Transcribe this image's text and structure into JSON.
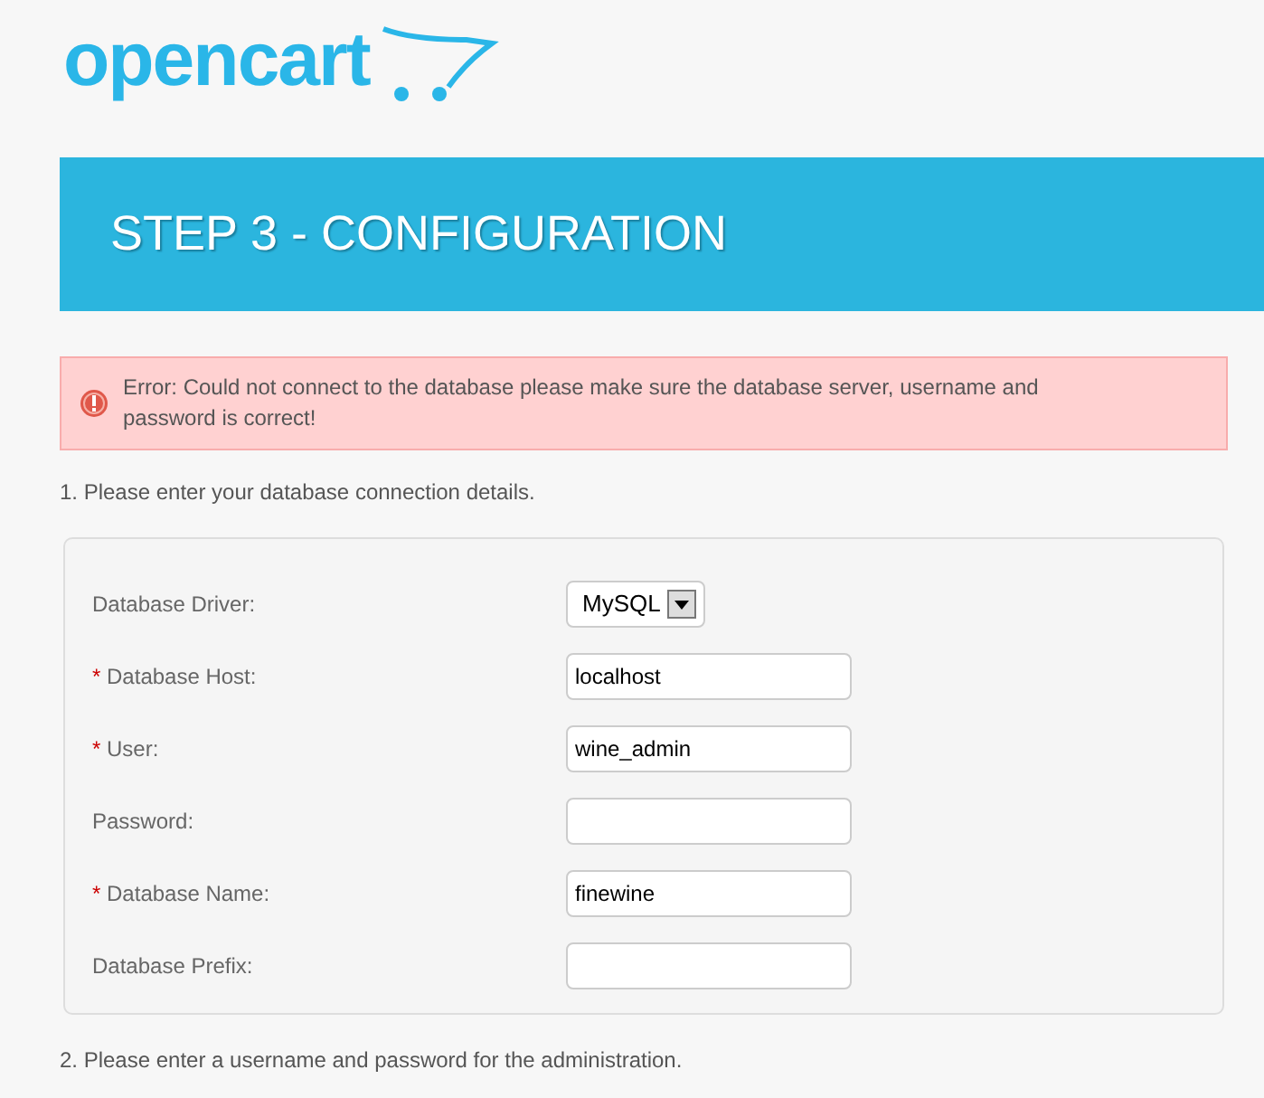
{
  "logo": {
    "text": "opencart"
  },
  "header": {
    "title": "STEP 3 - CONFIGURATION"
  },
  "error": {
    "message": "Error: Could not connect to the database please make sure the database server, username and password is correct!"
  },
  "sections": [
    {
      "heading": "1. Please enter your database connection details.",
      "fields": [
        {
          "kind": "select",
          "label": "Database Driver:",
          "value": "MySQL"
        },
        {
          "kind": "text",
          "required_mark": "*",
          "label": "Database Host:",
          "value": "localhost"
        },
        {
          "kind": "text",
          "required_mark": "*",
          "label": "User:",
          "value": "wine_admin"
        },
        {
          "kind": "text",
          "label": "Password:"
        },
        {
          "kind": "text",
          "required_mark": "*",
          "label": "Database Name:",
          "value": "finewine"
        },
        {
          "kind": "text",
          "label": "Database Prefix:"
        }
      ]
    },
    {
      "heading": "2. Please enter a username and password for the administration."
    }
  ]
}
